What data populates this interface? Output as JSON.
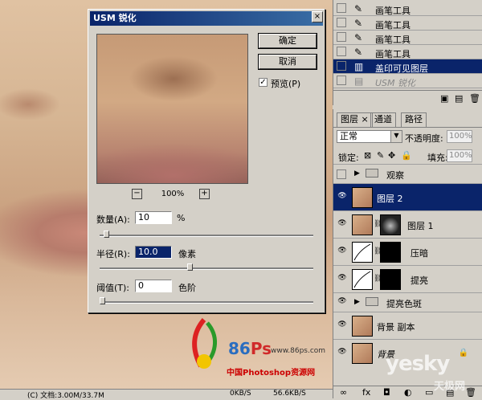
{
  "dialog": {
    "title": "USM 锐化",
    "ok_label": "确定",
    "cancel_label": "取消",
    "preview_label": "预览(P)",
    "preview_checked": true,
    "zoom": "100%",
    "amount_label": "数量(A):",
    "amount_value": "10",
    "amount_unit": "%",
    "amount_level": 0.02,
    "radius_label": "半径(R):",
    "radius_value": "10.0",
    "radius_unit": "像素",
    "radius_level": 0.42,
    "threshold_label": "阈值(T):",
    "threshold_value": "0",
    "threshold_unit": "色阶",
    "threshold_level": 0.0
  },
  "history": {
    "items": [
      {
        "label": "画笔工具",
        "icon": "brush-icon",
        "state": "normal"
      },
      {
        "label": "画笔工具",
        "icon": "brush-icon",
        "state": "normal"
      },
      {
        "label": "画笔工具",
        "icon": "brush-icon",
        "state": "normal"
      },
      {
        "label": "画笔工具",
        "icon": "brush-icon",
        "state": "normal"
      },
      {
        "label": "盖印可见图层",
        "icon": "stamp-layer-icon",
        "state": "selected"
      },
      {
        "label": "USM 锐化",
        "icon": "filter-icon",
        "state": "dim"
      }
    ]
  },
  "layers": {
    "tabs": [
      "图层",
      "通道",
      "路径"
    ],
    "blend_mode": "正常",
    "opacity_label": "不透明度:",
    "opacity_value": "100%",
    "lock_label": "锁定:",
    "fill_label": "填充:",
    "fill_value": "100%",
    "items": [
      {
        "name": "观察",
        "type": "folder",
        "visible": false
      },
      {
        "name": "图层 2",
        "type": "image",
        "visible": true,
        "selected": true
      },
      {
        "name": "图层 1",
        "type": "image-mask",
        "visible": true
      },
      {
        "name": "压暗",
        "type": "curves",
        "visible": true
      },
      {
        "name": "提亮",
        "type": "curves",
        "visible": true
      },
      {
        "name": "提亮色斑",
        "type": "folder",
        "visible": true
      },
      {
        "name": "背景 副本",
        "type": "image",
        "visible": true
      },
      {
        "name": "背景",
        "type": "image",
        "visible": true,
        "locked": true
      }
    ]
  },
  "status": {
    "text": "(C) 文档:3.00M/33.7M",
    "right_a": "0KB/S",
    "right_b": "56.6KB/S"
  },
  "watermark": {
    "logo_86": "86",
    "logo_ps": "Ps",
    "url": "www.86ps.com",
    "cn": "中国Photoshop资源网",
    "yesky": "yesky",
    "yesky_cn": "天极网"
  }
}
